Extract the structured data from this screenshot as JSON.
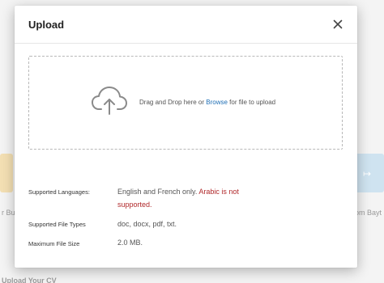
{
  "background": {
    "left_caption": "r Bu",
    "right_caption": "om Bayt",
    "bottom_caption": "Upload Your CV"
  },
  "modal": {
    "title": "Upload",
    "close_icon": "close-icon"
  },
  "dropzone": {
    "icon": "cloud-upload-icon",
    "text_before": "Drag and Drop here or ",
    "browse_label": "Browse",
    "text_after": " for file to upload"
  },
  "info": {
    "languages_label": "Supported Languages:",
    "languages_value": "English and French only.",
    "languages_warning": "Arabic is not supported.",
    "file_types_label": "Supported File Types",
    "file_types_value": "doc, docx, pdf, txt.",
    "max_size_label": "Maximum File Size",
    "max_size_value": "2.0 MB."
  },
  "colors": {
    "link": "#1f6fb5",
    "warning": "#b0282a"
  }
}
